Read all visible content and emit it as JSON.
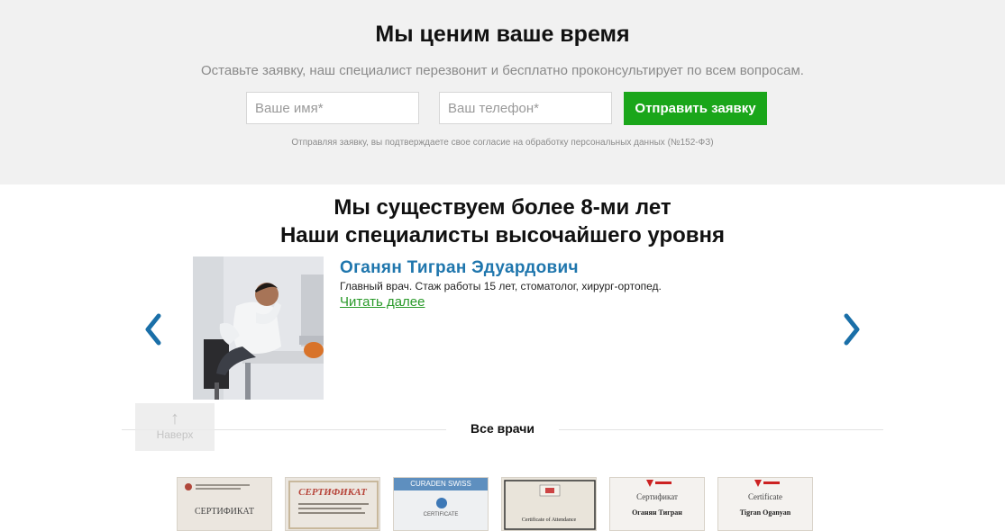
{
  "request": {
    "title": "Мы ценим ваше время",
    "subtitle": "Оставьте заявку, наш специалист перезвонит и бесплатно проконсультирует по всем вопросам.",
    "name_placeholder": "Ваше имя*",
    "phone_placeholder": "Ваш телефон*",
    "submit_label": "Отправить заявку",
    "consent": "Отправляя заявку, вы подтверждаете свое согласие на обработку персональных данных (№152-ФЗ)"
  },
  "about": {
    "heading_line1": "Мы существуем более 8-ми лет",
    "heading_line2": "Наши специалисты высочайшего уровня"
  },
  "doctor": {
    "name": "Оганян Тигран Эдуардович",
    "description": "Главный врач. Стаж работы 15 лет, стоматолог, хирург-ортопед.",
    "more_link": "Читать далее"
  },
  "all_doctors_label": "Все врачи",
  "back_to_top": {
    "arrow": "↑",
    "label": "Наверх"
  },
  "certificates": [
    {
      "title": "СЕРТИФИКАТ",
      "subtitle": ""
    },
    {
      "title": "СЕРТИФИКАТ",
      "subtitle": ""
    },
    {
      "title": "CURADEN SWISS",
      "subtitle": "CERTIFICATE"
    },
    {
      "title": "Certificate of Attendance",
      "subtitle": ""
    },
    {
      "title": "Сертификат",
      "subtitle": "Оганян Тигран"
    },
    {
      "title": "Certificate",
      "subtitle": "Tigran Oganyan"
    }
  ],
  "colors": {
    "accent_green": "#1aa61a",
    "link_blue": "#1f76ad",
    "arrow_blue": "#1a6fa8"
  },
  "icons": {
    "prev": "chevron-left-icon",
    "next": "chevron-right-icon",
    "up": "arrow-up-icon"
  }
}
